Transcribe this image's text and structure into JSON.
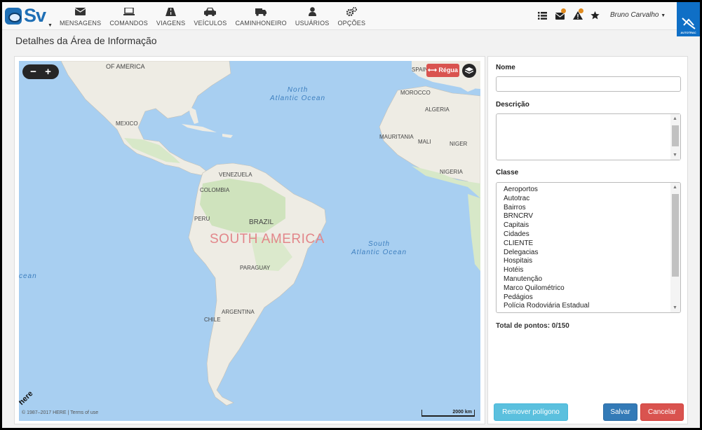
{
  "app": {
    "logo_text": "Sv"
  },
  "menu": [
    {
      "label": "MENSAGENS",
      "icon": "envelope-icon"
    },
    {
      "label": "COMANDOS",
      "icon": "laptop-icon"
    },
    {
      "label": "VIAGENS",
      "icon": "road-icon"
    },
    {
      "label": "VEÍCULOS",
      "icon": "car-icon"
    },
    {
      "label": "CAMINHONEIRO",
      "icon": "truck-icon"
    },
    {
      "label": "USUÁRIOS",
      "icon": "user-icon"
    },
    {
      "label": "OPÇÕES",
      "icon": "cogs-icon"
    }
  ],
  "header": {
    "user_name": "Bruno Carvalho",
    "brand_text": "AUTOTRAC",
    "tools": [
      "list-icon",
      "mail-alert-icon",
      "warning-icon",
      "star-icon"
    ],
    "badge_color": "#e08a1e"
  },
  "page": {
    "title": "Detalhes da Área de Informação"
  },
  "map": {
    "ruler_label": "⟷ Régua",
    "attribution": "© 1987–2017 HERE | Terms of use",
    "logo_text": "here",
    "scale_label": "2000 km",
    "continent_label": "SOUTH AMERICA",
    "oceans": [
      {
        "label": "North\nAtlantic Ocean"
      },
      {
        "label": "South\nAtlantic Ocean"
      },
      {
        "label": "cean"
      }
    ],
    "countries": [
      "OF AMERICA",
      "MEXICO",
      "VENEZUELA",
      "COLOMBIA",
      "PERU",
      "BRAZIL",
      "PARAGUAY",
      "ARGENTINA",
      "CHILE",
      "SPAIN",
      "MOROCCO",
      "ALGERIA",
      "MAURITANIA",
      "MALI",
      "NIGER",
      "NIGERIA"
    ]
  },
  "form": {
    "name_label": "Nome",
    "name_value": "",
    "description_label": "Descrição",
    "description_value": "",
    "class_label": "Classe",
    "classes": [
      "Aeroportos",
      "Autotrac",
      "Bairros",
      "BRNCRV",
      "Capitais",
      "Cidades",
      "CLIENTE",
      "Delegacias",
      "Hospitais",
      "Hotéis",
      "Manutenção",
      "Marco Quilométrico",
      "Pedágios",
      "Polícia Rodoviária Estadual"
    ],
    "total_label": "Total de pontos: 0/150",
    "remove_button": "Remover polígono",
    "save_button": "Salvar",
    "cancel_button": "Cancelar"
  },
  "colors": {
    "primary": "#337ab7",
    "danger": "#d9534f",
    "info": "#5bc0de",
    "brand": "#0f6fc6",
    "ocean": "#a8cff1",
    "land": "#f1efe9"
  }
}
